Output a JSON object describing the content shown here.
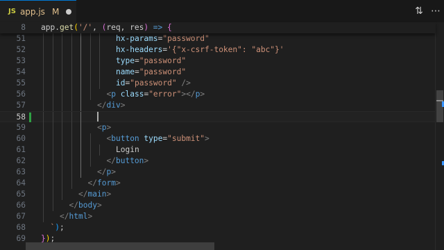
{
  "tab": {
    "lang_badge": "JS",
    "filename": "app.js",
    "git_status": "M",
    "status_color": "#e2c08d",
    "dirty_icon": "unsaved-dot-icon"
  },
  "toolbar": {
    "compare_icon": "compare-changes-icon",
    "more_icon": "more-actions-icon"
  },
  "editor": {
    "cursor_line": "58",
    "sticky_line": {
      "num": "8",
      "tokens": [
        {
          "t": "app",
          "c": "plain"
        },
        {
          "t": ".",
          "c": "plain"
        },
        {
          "t": "get",
          "c": "fn"
        },
        {
          "t": "(",
          "c": "b1"
        },
        {
          "t": "'/'",
          "c": "str"
        },
        {
          "t": ", ",
          "c": "plain"
        },
        {
          "t": "(",
          "c": "b2"
        },
        {
          "t": "req",
          "c": "plain"
        },
        {
          "t": ", ",
          "c": "plain"
        },
        {
          "t": "res",
          "c": "plain"
        },
        {
          "t": ")",
          "c": "b2"
        },
        {
          "t": " => ",
          "c": "kw"
        },
        {
          "t": "{",
          "c": "b2"
        }
      ]
    },
    "lines": [
      {
        "num": "51",
        "indent": 8,
        "guides": [
          1,
          2,
          3,
          4,
          5,
          6,
          7
        ],
        "tokens": [
          {
            "t": "hx-params",
            "c": "attr"
          },
          {
            "t": "=",
            "c": "plain"
          },
          {
            "t": "\"password\"",
            "c": "str"
          }
        ]
      },
      {
        "num": "52",
        "indent": 8,
        "guides": [
          1,
          2,
          3,
          4,
          5,
          6,
          7
        ],
        "tokens": [
          {
            "t": "hx-headers",
            "c": "attr"
          },
          {
            "t": "=",
            "c": "plain"
          },
          {
            "t": "'{\"x-csrf-token\": \"abc\"}'",
            "c": "str"
          }
        ]
      },
      {
        "num": "53",
        "indent": 8,
        "guides": [
          1,
          2,
          3,
          4,
          5,
          6,
          7
        ],
        "tokens": [
          {
            "t": "type",
            "c": "attr"
          },
          {
            "t": "=",
            "c": "plain"
          },
          {
            "t": "\"password\"",
            "c": "str"
          }
        ]
      },
      {
        "num": "54",
        "indent": 8,
        "guides": [
          1,
          2,
          3,
          4,
          5,
          6,
          7
        ],
        "tokens": [
          {
            "t": "name",
            "c": "attr"
          },
          {
            "t": "=",
            "c": "plain"
          },
          {
            "t": "\"password\"",
            "c": "str"
          }
        ]
      },
      {
        "num": "55",
        "indent": 8,
        "guides": [
          1,
          2,
          3,
          4,
          5,
          6,
          7
        ],
        "tokens": [
          {
            "t": "id",
            "c": "attr"
          },
          {
            "t": "=",
            "c": "plain"
          },
          {
            "t": "\"password\"",
            "c": "str"
          },
          {
            "t": " />",
            "c": "tag"
          }
        ]
      },
      {
        "num": "56",
        "indent": 7,
        "guides": [
          1,
          2,
          3,
          4,
          5,
          6
        ],
        "tokens": [
          {
            "t": "<",
            "c": "tag"
          },
          {
            "t": "p",
            "c": "name"
          },
          {
            "t": " ",
            "c": "plain"
          },
          {
            "t": "class",
            "c": "attr"
          },
          {
            "t": "=",
            "c": "plain"
          },
          {
            "t": "\"error\"",
            "c": "str"
          },
          {
            "t": "></",
            "c": "tag"
          },
          {
            "t": "p",
            "c": "name"
          },
          {
            "t": ">",
            "c": "tag"
          }
        ]
      },
      {
        "num": "57",
        "indent": 6,
        "guides": [
          1,
          2,
          3,
          4,
          5
        ],
        "tokens": [
          {
            "t": "</",
            "c": "tag"
          },
          {
            "t": "div",
            "c": "name"
          },
          {
            "t": ">",
            "c": "tag"
          }
        ]
      },
      {
        "num": "58",
        "indent": 6,
        "guides": [
          1,
          2,
          3,
          4,
          5
        ],
        "cursor": true,
        "modified": true,
        "tokens": []
      },
      {
        "num": "59",
        "indent": 6,
        "guides": [
          1,
          2,
          3,
          4,
          5
        ],
        "tokens": [
          {
            "t": "<",
            "c": "tag"
          },
          {
            "t": "p",
            "c": "name"
          },
          {
            "t": ">",
            "c": "tag"
          }
        ]
      },
      {
        "num": "60",
        "indent": 7,
        "guides": [
          1,
          2,
          3,
          4,
          5,
          6
        ],
        "tokens": [
          {
            "t": "<",
            "c": "tag"
          },
          {
            "t": "button",
            "c": "name"
          },
          {
            "t": " ",
            "c": "plain"
          },
          {
            "t": "type",
            "c": "attr"
          },
          {
            "t": "=",
            "c": "plain"
          },
          {
            "t": "\"submit\"",
            "c": "str"
          },
          {
            "t": ">",
            "c": "tag"
          }
        ]
      },
      {
        "num": "61",
        "indent": 8,
        "guides": [
          1,
          2,
          3,
          4,
          5,
          6,
          7
        ],
        "tokens": [
          {
            "t": "Login",
            "c": "plain"
          }
        ]
      },
      {
        "num": "62",
        "indent": 7,
        "guides": [
          1,
          2,
          3,
          4,
          5,
          6
        ],
        "tokens": [
          {
            "t": "</",
            "c": "tag"
          },
          {
            "t": "button",
            "c": "name"
          },
          {
            "t": ">",
            "c": "tag"
          }
        ]
      },
      {
        "num": "63",
        "indent": 6,
        "guides": [
          1,
          2,
          3,
          4,
          5
        ],
        "tokens": [
          {
            "t": "</",
            "c": "tag"
          },
          {
            "t": "p",
            "c": "name"
          },
          {
            "t": ">",
            "c": "tag"
          }
        ]
      },
      {
        "num": "64",
        "indent": 5,
        "guides": [
          1,
          2,
          3,
          4
        ],
        "tokens": [
          {
            "t": "</",
            "c": "tag"
          },
          {
            "t": "form",
            "c": "name"
          },
          {
            "t": ">",
            "c": "tag"
          }
        ]
      },
      {
        "num": "65",
        "indent": 4,
        "guides": [
          1,
          2,
          3
        ],
        "tokens": [
          {
            "t": "</",
            "c": "tag"
          },
          {
            "t": "main",
            "c": "name"
          },
          {
            "t": ">",
            "c": "tag"
          }
        ]
      },
      {
        "num": "66",
        "indent": 3,
        "guides": [
          1,
          2
        ],
        "tokens": [
          {
            "t": "</",
            "c": "tag"
          },
          {
            "t": "body",
            "c": "name"
          },
          {
            "t": ">",
            "c": "tag"
          }
        ]
      },
      {
        "num": "67",
        "indent": 2,
        "guides": [
          1
        ],
        "tokens": [
          {
            "t": "</",
            "c": "tag"
          },
          {
            "t": "html",
            "c": "name"
          },
          {
            "t": ">",
            "c": "tag"
          }
        ]
      },
      {
        "num": "68",
        "indent": 1,
        "guides": [],
        "tokens": [
          {
            "t": "`",
            "c": "str"
          },
          {
            "t": ")",
            "c": "b3"
          },
          {
            "t": ";",
            "c": "plain"
          }
        ]
      },
      {
        "num": "69",
        "indent": 0,
        "guides": [],
        "tokens": [
          {
            "t": "}",
            "c": "b2"
          },
          {
            "t": ")",
            "c": "b1"
          },
          {
            "t": ";",
            "c": "plain"
          }
        ]
      }
    ]
  }
}
